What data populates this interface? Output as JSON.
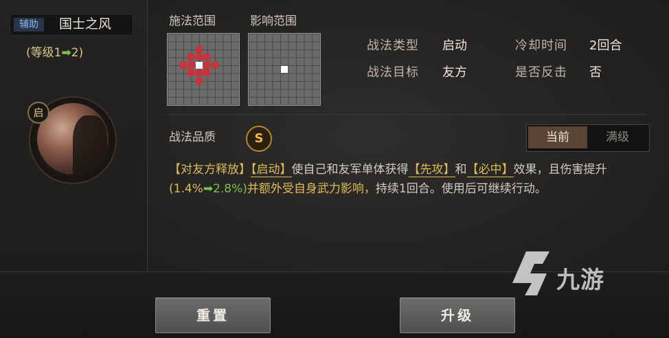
{
  "skill": {
    "type_tag": "辅助",
    "name": "国士之风",
    "level_prefix": "(等级1",
    "level_arrow": "➡",
    "level_suffix": "2)",
    "trigger_badge": "启"
  },
  "range": {
    "cast_label": "施法范围",
    "effect_label": "影响范围"
  },
  "props": {
    "type_label": "战法类型",
    "type_value": "启动",
    "cooldown_label": "冷却时间",
    "cooldown_value": "2回合",
    "target_label": "战法目标",
    "target_value": "友方",
    "counter_label": "是否反击",
    "counter_value": "否"
  },
  "quality": {
    "label": "战法品质",
    "grade": "S"
  },
  "tabs": {
    "current": "当前",
    "max": "满级"
  },
  "description": {
    "part1": "【对友方释放】",
    "part2": "【启动】",
    "part3": "使自己和友军单体获得",
    "part4": "【先攻】",
    "part5": "和",
    "part6": "【必中】",
    "part7": "效果，且伤害提升",
    "part8": "(1.4%",
    "part9": "➡2.8%)",
    "part10": "并额外受自身武力影响，",
    "part11": "持续1回合。使用后可继续行动。"
  },
  "buttons": {
    "reset": "重置",
    "upgrade": "升级"
  },
  "watermark": {
    "text": "九游"
  },
  "colors": {
    "accent_gold": "#e0bc57",
    "accent_green": "#7bc34a",
    "range_red": "#c8343c"
  }
}
